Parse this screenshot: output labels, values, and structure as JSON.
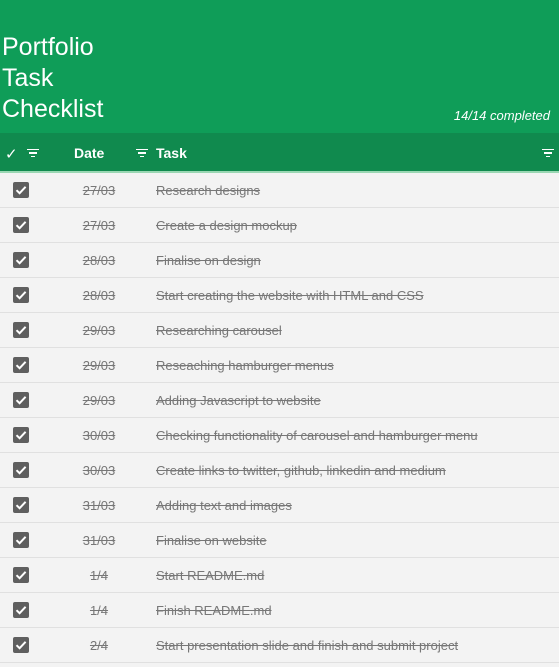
{
  "header": {
    "title_lines": [
      "Portfolio",
      "Task",
      "Checklist"
    ],
    "progress": "14/14 completed",
    "color": "#0f9d58"
  },
  "columns": {
    "check": "✓",
    "date": "Date",
    "task": "Task",
    "color": "#108a4e"
  },
  "tasks": [
    {
      "date": "27/03",
      "task": "Research designs",
      "done": true
    },
    {
      "date": "27/03",
      "task": "Create a design mockup",
      "done": true
    },
    {
      "date": "28/03",
      "task": "Finalise on design",
      "done": true
    },
    {
      "date": "28/03",
      "task": "Start creating the website with HTML and CSS",
      "done": true
    },
    {
      "date": "29/03",
      "task": "Researching carousel",
      "done": true
    },
    {
      "date": "29/03",
      "task": "Reseaching hamburger menus",
      "done": true
    },
    {
      "date": "29/03",
      "task": "Adding Javascript to website",
      "done": true
    },
    {
      "date": "30/03",
      "task": "Checking functionality of carousel and hamburger menu",
      "done": true
    },
    {
      "date": "30/03",
      "task": "Create links to twitter, github, linkedin and medium",
      "done": true
    },
    {
      "date": "31/03",
      "task": "Adding text and images",
      "done": true
    },
    {
      "date": "31/03",
      "task": "Finalise on website",
      "done": true
    },
    {
      "date": "1/4",
      "task": "Start README.md",
      "done": true
    },
    {
      "date": "1/4",
      "task": "Finish README.md",
      "done": true
    },
    {
      "date": "2/4",
      "task": "Start presentation slide and finish and submit project",
      "done": true
    }
  ]
}
